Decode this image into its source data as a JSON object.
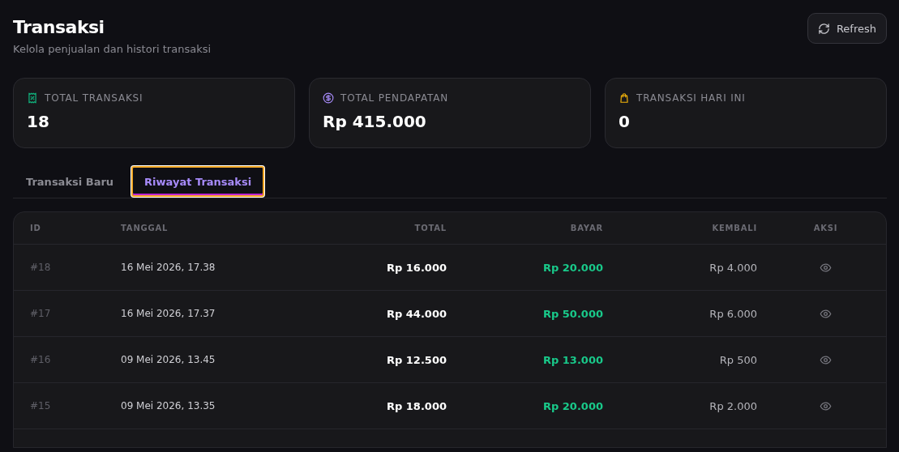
{
  "header": {
    "title": "Transaksi",
    "subtitle": "Kelola penjualan dan histori transaksi",
    "refresh_button": "Refresh"
  },
  "stats": [
    {
      "kind": "receipt",
      "label": "TOTAL TRANSAKSI",
      "value": "18"
    },
    {
      "kind": "money",
      "label": "TOTAL PENDAPATAN",
      "value": "Rp 415.000"
    },
    {
      "kind": "bag",
      "label": "TRANSAKSI HARI INI",
      "value": "0"
    }
  ],
  "tabs": [
    {
      "label": "Transaksi Baru",
      "selected": false
    },
    {
      "label": "Riwayat Transaksi",
      "selected": true
    }
  ],
  "table": {
    "columns": [
      "ID",
      "TANGGAL",
      "TOTAL",
      "BAYAR",
      "KEMBALI",
      "AKSI"
    ],
    "rows": [
      {
        "id": "#18",
        "date": "16 Mei 2026, 17.38",
        "total": "Rp 16.000",
        "paid": "Rp 20.000",
        "change": "Rp 4.000"
      },
      {
        "id": "#17",
        "date": "16 Mei 2026, 17.37",
        "total": "Rp 44.000",
        "paid": "Rp 50.000",
        "change": "Rp 6.000"
      },
      {
        "id": "#16",
        "date": "09 Mei 2026, 13.45",
        "total": "Rp 12.500",
        "paid": "Rp 13.000",
        "change": "Rp 500"
      },
      {
        "id": "#15",
        "date": "09 Mei 2026, 13.35",
        "total": "Rp 18.000",
        "paid": "Rp 20.000",
        "change": "Rp 2.000"
      }
    ]
  }
}
